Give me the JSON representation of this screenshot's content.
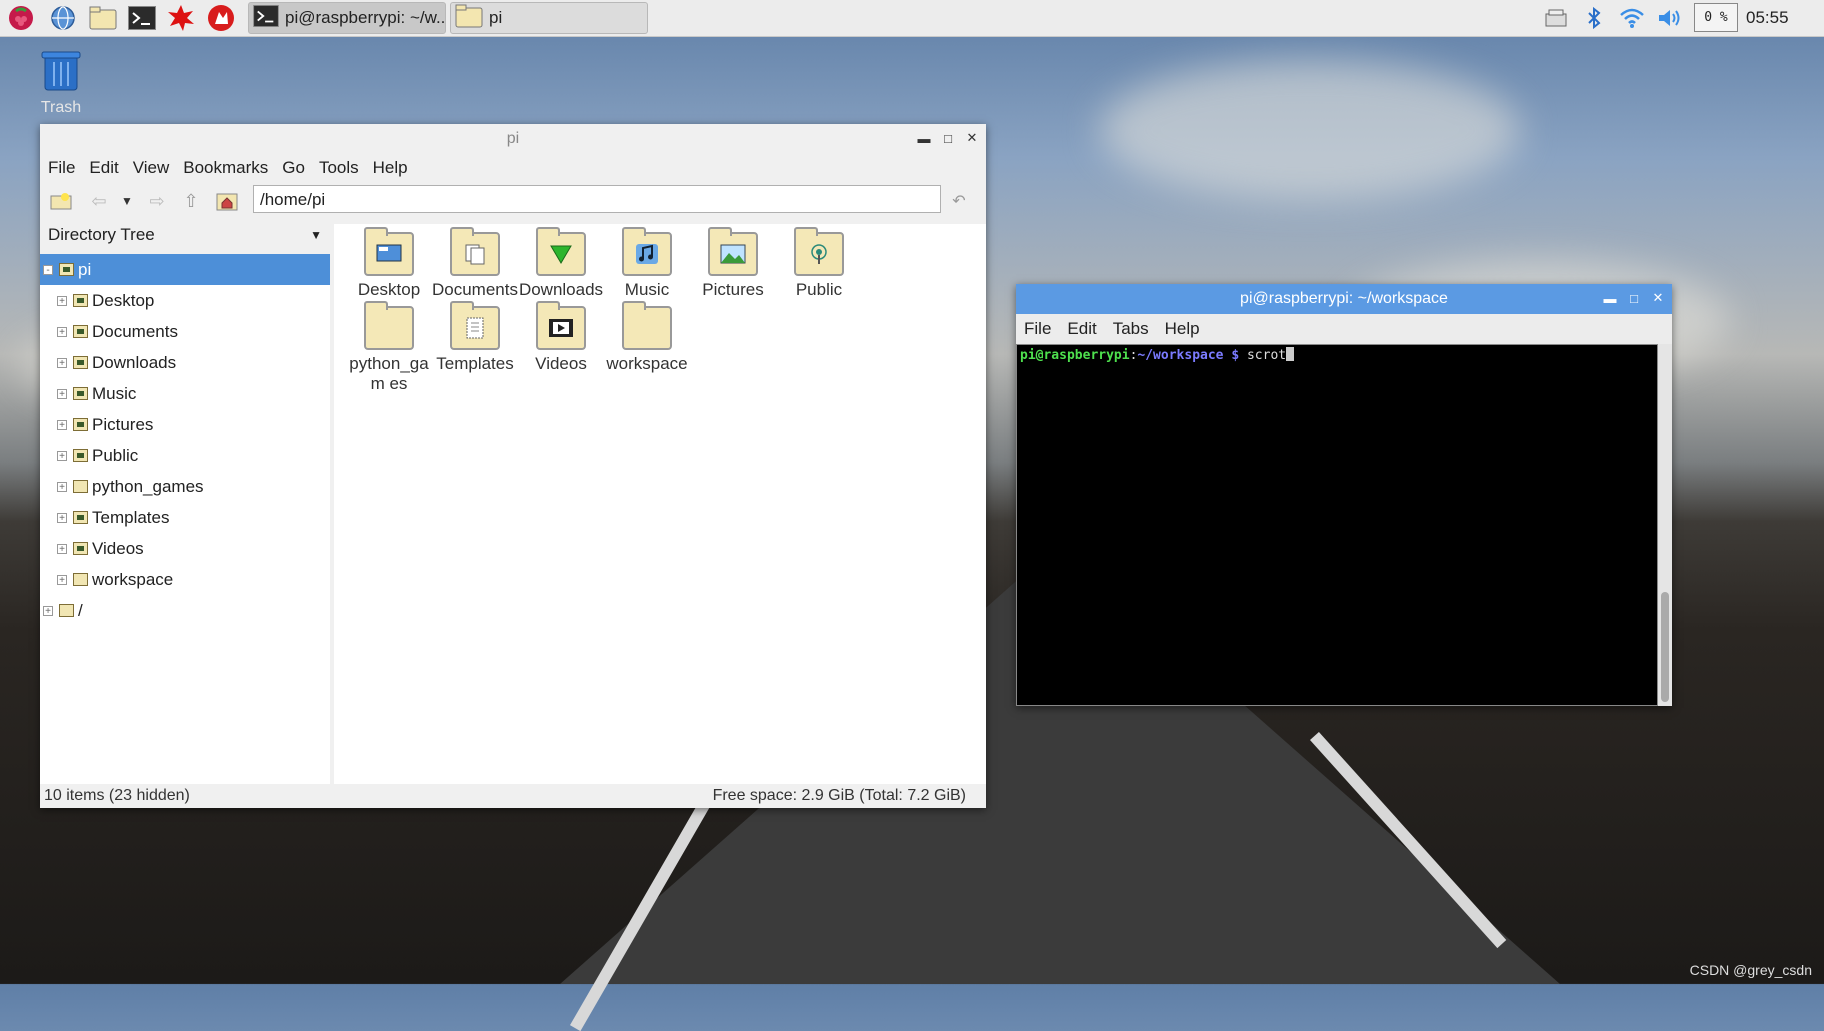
{
  "taskbar": {
    "launchers": [
      "raspberry-menu-icon",
      "web-browser-icon",
      "file-manager-icon",
      "terminal-icon",
      "math-icon",
      "wolfram-icon"
    ],
    "tasks": [
      {
        "label": "pi@raspberrypi: ~/w...",
        "icon": "terminal-icon"
      },
      {
        "label": "pi",
        "icon": "folder-icon"
      }
    ],
    "cpu": "0 %",
    "clock": "05:55"
  },
  "desktop": {
    "trash_label": "Trash"
  },
  "file_manager": {
    "title": "pi",
    "menu": [
      "File",
      "Edit",
      "View",
      "Bookmarks",
      "Go",
      "Tools",
      "Help"
    ],
    "path": "/home/pi",
    "sidebar_header": "Directory Tree",
    "tree": [
      {
        "label": "pi",
        "selected": true
      },
      {
        "label": "Desktop"
      },
      {
        "label": "Documents"
      },
      {
        "label": "Downloads"
      },
      {
        "label": "Music"
      },
      {
        "label": "Pictures"
      },
      {
        "label": "Public"
      },
      {
        "label": "python_games"
      },
      {
        "label": "Templates"
      },
      {
        "label": "Videos"
      },
      {
        "label": "workspace"
      },
      {
        "label": "/"
      }
    ],
    "items": [
      {
        "label": "Desktop",
        "emblem": "desktop"
      },
      {
        "label": "Documents",
        "emblem": "documents"
      },
      {
        "label": "Downloads",
        "emblem": "downloads"
      },
      {
        "label": "Music",
        "emblem": "music"
      },
      {
        "label": "Pictures",
        "emblem": "pictures"
      },
      {
        "label": "Public",
        "emblem": "public"
      },
      {
        "label": "python_gam es",
        "emblem": "none"
      },
      {
        "label": "Templates",
        "emblem": "templates"
      },
      {
        "label": "Videos",
        "emblem": "videos"
      },
      {
        "label": "workspace",
        "emblem": "none"
      }
    ],
    "status_left": "10 items (23 hidden)",
    "status_right": "Free space: 2.9 GiB (Total: 7.2 GiB)"
  },
  "terminal": {
    "title": "pi@raspberrypi: ~/workspace",
    "menu": [
      "File",
      "Edit",
      "Tabs",
      "Help"
    ],
    "prompt_user": "pi@raspberrypi",
    "prompt_sep": ":",
    "prompt_path": "~/workspace $",
    "command": " scrot",
    "colors": {
      "user": "#4ee04e",
      "path": "#6f6fff"
    }
  },
  "watermark": "CSDN @grey_csdn"
}
